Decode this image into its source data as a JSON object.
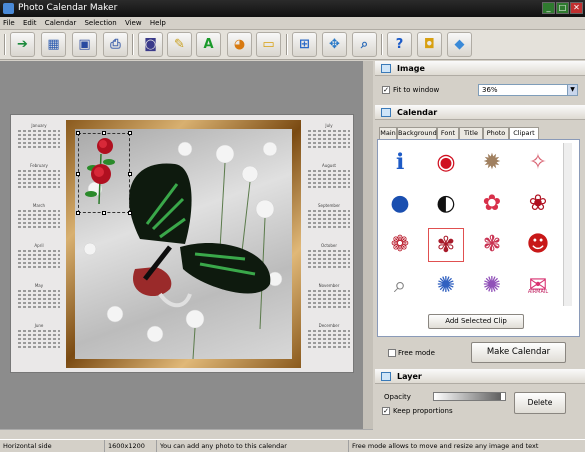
{
  "window": {
    "title": "Photo Calendar Maker",
    "minimize": "_",
    "maximize": "□",
    "close": "✕"
  },
  "menu": [
    "File",
    "Edit",
    "Calendar",
    "Selection",
    "View",
    "Help"
  ],
  "toolbar": [
    {
      "name": "import-icon",
      "glyph": "➔"
    },
    {
      "name": "calendar-icon",
      "glyph": "▦"
    },
    {
      "name": "save-icon",
      "glyph": "▣"
    },
    {
      "name": "print-icon",
      "glyph": "⎙"
    },
    {
      "name": "camera-icon",
      "glyph": "◙"
    },
    {
      "name": "edit-icon",
      "glyph": "✎"
    },
    {
      "name": "text-icon",
      "glyph": "A"
    },
    {
      "name": "color-icon",
      "glyph": "◕"
    },
    {
      "name": "image-icon",
      "glyph": "▭"
    },
    {
      "name": "fit-icon",
      "glyph": "⊞"
    },
    {
      "name": "move-icon",
      "glyph": "✥"
    },
    {
      "name": "zoom-icon",
      "glyph": "⌕"
    },
    {
      "name": "help-icon",
      "glyph": "?"
    },
    {
      "name": "shop-icon",
      "glyph": "◘"
    },
    {
      "name": "box-icon",
      "glyph": "◆"
    }
  ],
  "calendar_preview": {
    "months_left": [
      "January",
      "February",
      "March",
      "April",
      "May",
      "June"
    ],
    "months_right": [
      "July",
      "August",
      "September",
      "October",
      "November",
      "December"
    ]
  },
  "image_section": {
    "title": "Image",
    "fit_label": "Fit to window",
    "fit_checked": true,
    "zoom": "36%"
  },
  "calendar_section": {
    "title": "Calendar",
    "tabs": [
      "Main",
      "Background",
      "Font",
      "Title",
      "Photo",
      "Clipart"
    ],
    "active_tab": "Clipart",
    "cliparts": [
      {
        "name": "info-clip",
        "glyph": "ℹ",
        "color": "#1e5bc6"
      },
      {
        "name": "lips-clip",
        "glyph": "◉",
        "color": "#d01020"
      },
      {
        "name": "star-burst-clip",
        "glyph": "✹",
        "color": "#a08060"
      },
      {
        "name": "sparkle-clip",
        "glyph": "✧",
        "color": "#d86070"
      },
      {
        "name": "globe-clip",
        "glyph": "●",
        "color": "#1a4fb0"
      },
      {
        "name": "panda-clip",
        "glyph": "◐",
        "color": "#111111"
      },
      {
        "name": "rose-stem-clip",
        "glyph": "✿",
        "color": "#d8304a"
      },
      {
        "name": "rose-branch-clip",
        "glyph": "❀",
        "color": "#b01020"
      },
      {
        "name": "roses-clip",
        "glyph": "❁",
        "color": "#b81828"
      },
      {
        "name": "rose-bouquet-clip",
        "glyph": "✾",
        "color": "#a81a2a"
      },
      {
        "name": "pink-roses-clip",
        "glyph": "❃",
        "color": "#c83050"
      },
      {
        "name": "santa-clip",
        "glyph": "☻",
        "color": "#c81818"
      },
      {
        "name": "magnifier-clip",
        "glyph": "⌕",
        "color": "#808080"
      },
      {
        "name": "blue-star-clip",
        "glyph": "✺",
        "color": "#3060c0"
      },
      {
        "name": "purple-star-clip",
        "glyph": "✺",
        "color": "#9050b8"
      },
      {
        "name": "stamp-clip",
        "glyph": "✉",
        "color": "#d83070"
      }
    ],
    "stamp_text": "AIRMAIL",
    "add_button": "Add Selected Clip",
    "free_mode_label": "Free mode",
    "free_mode_checked": false,
    "make_button": "Make Calendar"
  },
  "layer_section": {
    "title": "Layer",
    "opacity_label": "Opacity",
    "opacity": 0.95,
    "keep_label": "Keep proportions",
    "keep_checked": true,
    "delete_button": "Delete"
  },
  "status": {
    "orientation": "Horizontal side",
    "resolution": "1600x1200",
    "hint": "You can add any photo to this calendar",
    "mode_hint": "Free mode allows to move and resize any image and text"
  }
}
